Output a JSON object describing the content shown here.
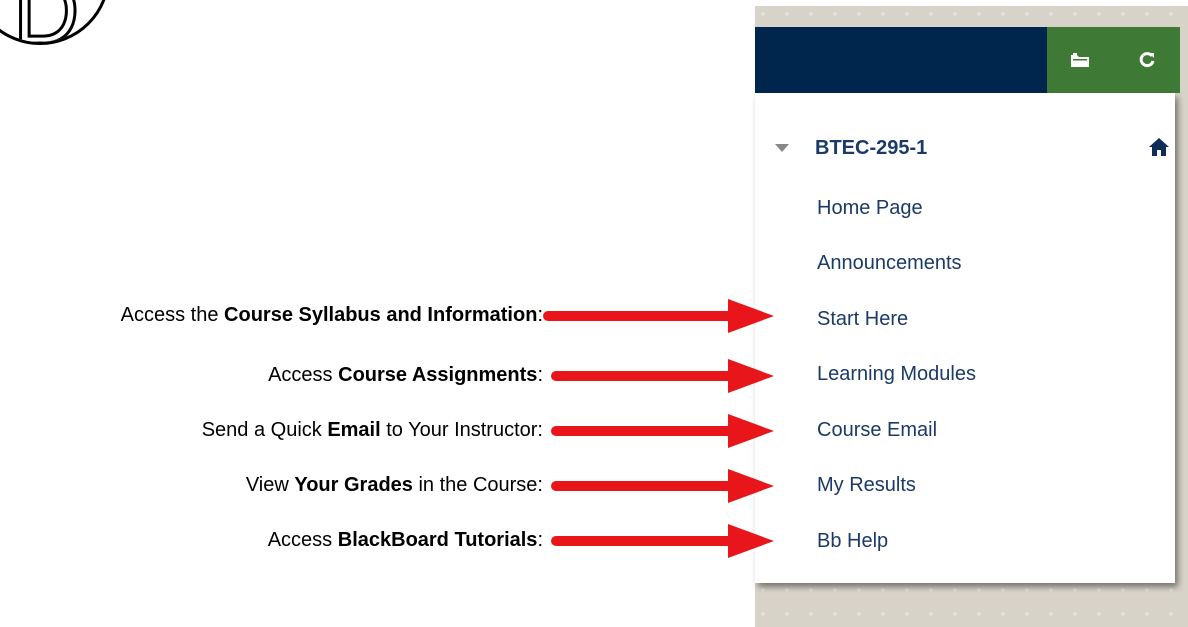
{
  "logo": {
    "letter": "D"
  },
  "toolbar": {
    "folder_icon": "folder-icon",
    "refresh_icon": "refresh-icon"
  },
  "course": {
    "title": "BTEC-295-1",
    "home_icon": "home-icon"
  },
  "menu": {
    "items": [
      {
        "label": "Home Page"
      },
      {
        "label": "Announcements"
      },
      {
        "label": "Start Here"
      },
      {
        "label": "Learning Modules"
      },
      {
        "label": "Course Email"
      },
      {
        "label": "My Results"
      },
      {
        "label": "Bb Help"
      }
    ]
  },
  "annotations": [
    {
      "pre": "Access the ",
      "bold": "Course Syllabus and Information",
      "post": ":"
    },
    {
      "pre": "Access ",
      "bold": "Course Assignments",
      "post": ":"
    },
    {
      "pre": "Send a Quick ",
      "bold": "Email",
      "post": " to Your Instructor:"
    },
    {
      "pre": "View ",
      "bold": "Your Grades",
      "post": " in the Course:"
    },
    {
      "pre": "Access ",
      "bold": "BlackBoard Tutorials",
      "post": ":"
    }
  ],
  "colors": {
    "nav_bar": "#00264d",
    "tools_bar": "#3e7a35",
    "menu_link": "#1b3a66",
    "arrow": "#e8161b"
  }
}
